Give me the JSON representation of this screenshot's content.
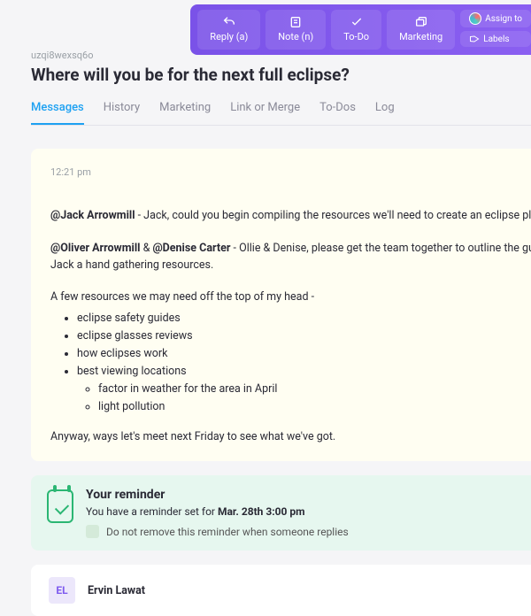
{
  "toolbar": {
    "reply": "Reply (a)",
    "note": "Note (n)",
    "todo": "To-Do",
    "marketing": "Marketing",
    "assign": "Assign to",
    "labels": "Labels"
  },
  "page": {
    "uid": "uzqi8wexsq6o",
    "title": "Where will you be for the next full eclipse?"
  },
  "tabs": [
    "Messages",
    "History",
    "Marketing",
    "Link or Merge",
    "To-Dos",
    "Log"
  ],
  "message": {
    "time": "12:21 pm",
    "m1": "@Jack Arrowmill",
    "t1": " - Jack, could you begin compiling the resources we'll need to create an eclipse planning guide?",
    "m2a": "@Oliver Arrowmill",
    "amp": " & ",
    "m2b": "@Denise Carter",
    "t2": " - Ollie & Denise, please get the team together to outline the guide, and give Jack a hand gathering resources.",
    "intro": "A few resources we may need off the top of my head -",
    "r1": "eclipse safety guides",
    "r2": "eclipse glasses reviews",
    "r3": "how eclipses work",
    "r4": "best viewing locations",
    "r4a": "factor in weather for the area in April",
    "r4b": "light pollution",
    "closing": "Anyway, ways let's meet next Friday to see what we've got."
  },
  "reminder": {
    "heading": "Your reminder",
    "prefix": "You have a reminder set for ",
    "date": "Mar. 28th 3:00 pm",
    "cbtext": "Do not remove this reminder when someone replies"
  },
  "person": {
    "initials": "EL",
    "name": "Ervin Lawat"
  }
}
